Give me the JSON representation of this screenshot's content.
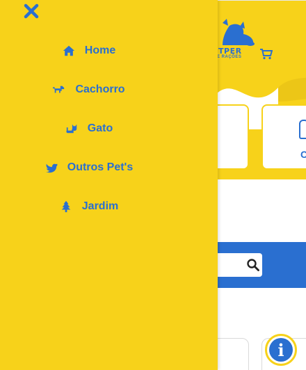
{
  "menu": {
    "items": [
      {
        "label": "Home",
        "icon": "home-icon"
      },
      {
        "label": "Cachorro",
        "icon": "dog-icon"
      },
      {
        "label": "Gato",
        "icon": "cat-icon"
      },
      {
        "label": "Outros Pet's",
        "icon": "bird-icon"
      },
      {
        "label": "Jardim",
        "icon": "tree-icon"
      }
    ],
    "close_icon": "close-icon"
  },
  "header": {
    "logo_text": "TPER",
    "logo_sub": "E RAÇÕES",
    "cart_icon": "cart-icon"
  },
  "category_card": {
    "letter": "C"
  },
  "search": {
    "button_icon": "search-icon"
  },
  "help_button": {
    "label": "i"
  },
  "colors": {
    "brand_yellow": "#f7d21a",
    "brand_blue": "#2a6fd0",
    "background": "#ffffff"
  }
}
